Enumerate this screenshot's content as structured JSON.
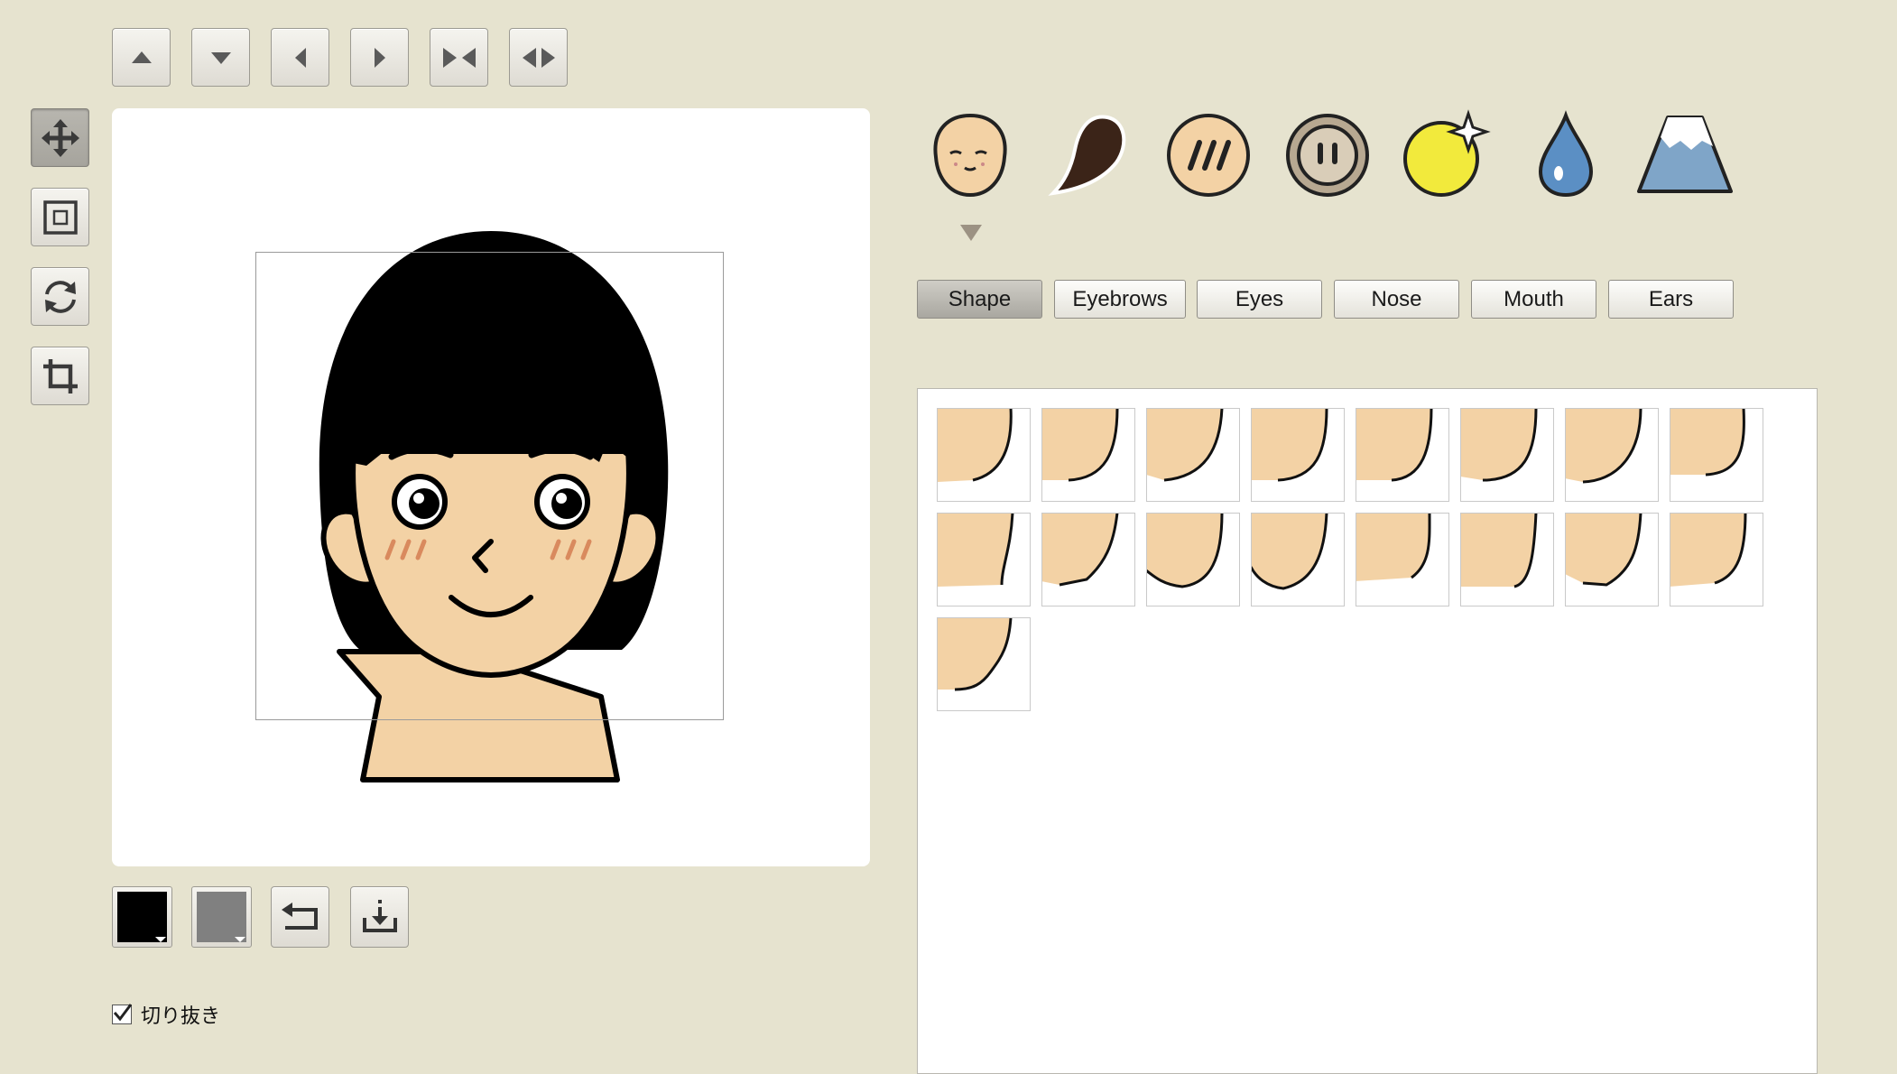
{
  "toolbar_top": {
    "buttons": [
      {
        "icon": "arrow-up-icon"
      },
      {
        "icon": "arrow-down-icon"
      },
      {
        "icon": "arrow-left-icon"
      },
      {
        "icon": "arrow-right-icon"
      },
      {
        "icon": "flip-horizontal-in-icon"
      },
      {
        "icon": "flip-horizontal-out-icon"
      }
    ]
  },
  "toolbar_left": {
    "buttons": [
      {
        "icon": "move-icon",
        "active": true
      },
      {
        "icon": "resize-frame-icon",
        "active": false
      },
      {
        "icon": "rotate-icon",
        "active": false
      },
      {
        "icon": "crop-icon",
        "active": false
      }
    ]
  },
  "categories": [
    {
      "icon": "face-icon",
      "selected": true
    },
    {
      "icon": "hair-icon",
      "selected": false
    },
    {
      "icon": "cheek-blush-icon",
      "selected": false
    },
    {
      "icon": "button-accessory-icon",
      "selected": false
    },
    {
      "icon": "sparkle-ball-icon",
      "selected": false
    },
    {
      "icon": "drop-icon",
      "selected": false
    },
    {
      "icon": "mountain-background-icon",
      "selected": false
    }
  ],
  "tabs": [
    {
      "label": "Shape",
      "active": true
    },
    {
      "label": "Eyebrows",
      "active": false
    },
    {
      "label": "Eyes",
      "active": false
    },
    {
      "label": "Nose",
      "active": false
    },
    {
      "label": "Mouth",
      "active": false
    },
    {
      "label": "Ears",
      "active": false
    }
  ],
  "parts": {
    "count": 17
  },
  "colors": {
    "background": "#e6e3cf",
    "skin": "#f3d2a5",
    "hair": "#000000",
    "primary_swatch": "#000000",
    "secondary_swatch": "#808080",
    "blush": "#d98a5e"
  },
  "bottom_toolbar": {
    "buttons": [
      {
        "icon": "primary-color-swatch-icon"
      },
      {
        "icon": "secondary-color-swatch-icon"
      },
      {
        "icon": "undo-icon"
      },
      {
        "icon": "download-icon"
      }
    ]
  },
  "crop_option": {
    "label": "切り抜き",
    "checked": true
  }
}
